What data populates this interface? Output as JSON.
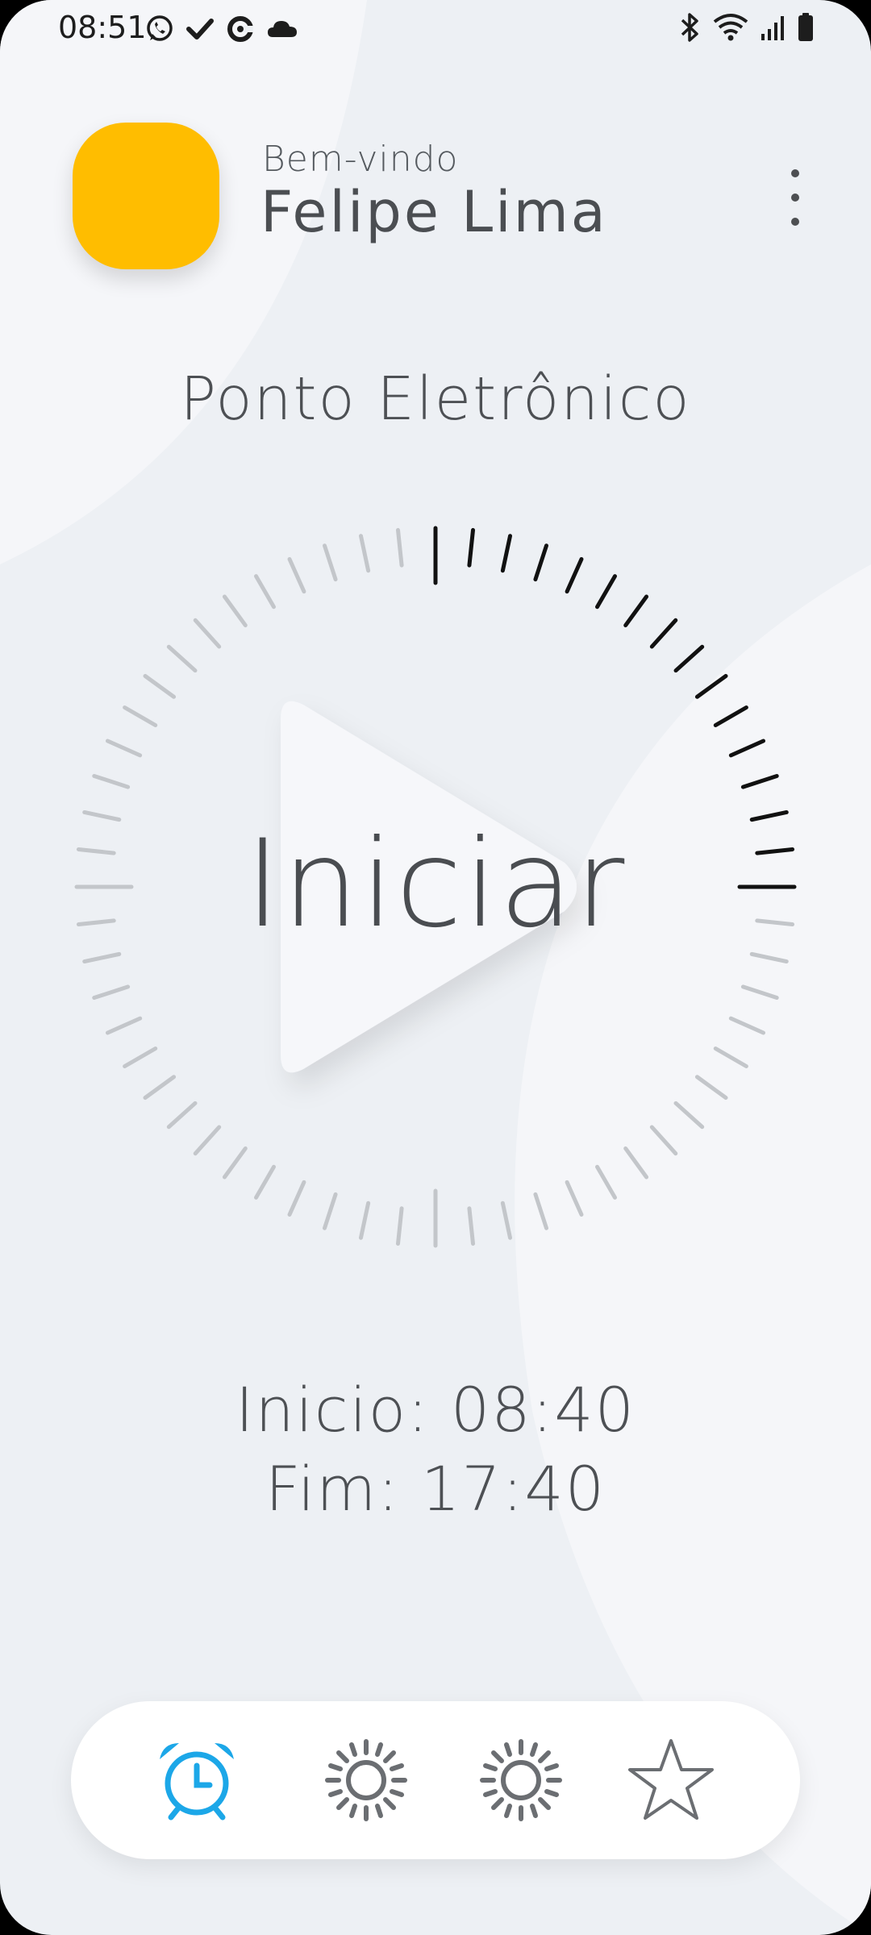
{
  "status_bar": {
    "time": "08:51",
    "left_icons": [
      "whatsapp-icon",
      "check-icon",
      "sync-icon",
      "cloud-icon"
    ],
    "right_icons": [
      "bluetooth-icon",
      "wifi-icon",
      "signal-icon",
      "battery-icon"
    ]
  },
  "header": {
    "welcome": "Bem-vindo",
    "user_name": "Felipe Lima",
    "avatar_color": "#ffbd00",
    "menu_icon": "more-vert-icon"
  },
  "main": {
    "title": "Ponto Eletrônico",
    "start_label": "Iniciar",
    "dial": {
      "ticks_total": 60,
      "ticks_active": 15,
      "active_color": "#111111",
      "inactive_color": "#c3c6ca"
    },
    "schedule": {
      "start": "Inicio: 08:40",
      "end": "Fim: 17:40"
    }
  },
  "bottom_nav": {
    "items": [
      {
        "icon": "alarm-clock-icon",
        "active": true
      },
      {
        "icon": "sun-icon",
        "active": false
      },
      {
        "icon": "sun-icon",
        "active": false
      },
      {
        "icon": "star-icon",
        "active": false
      }
    ],
    "active_color": "#1ca7e8",
    "inactive_color": "#6b6e72"
  }
}
